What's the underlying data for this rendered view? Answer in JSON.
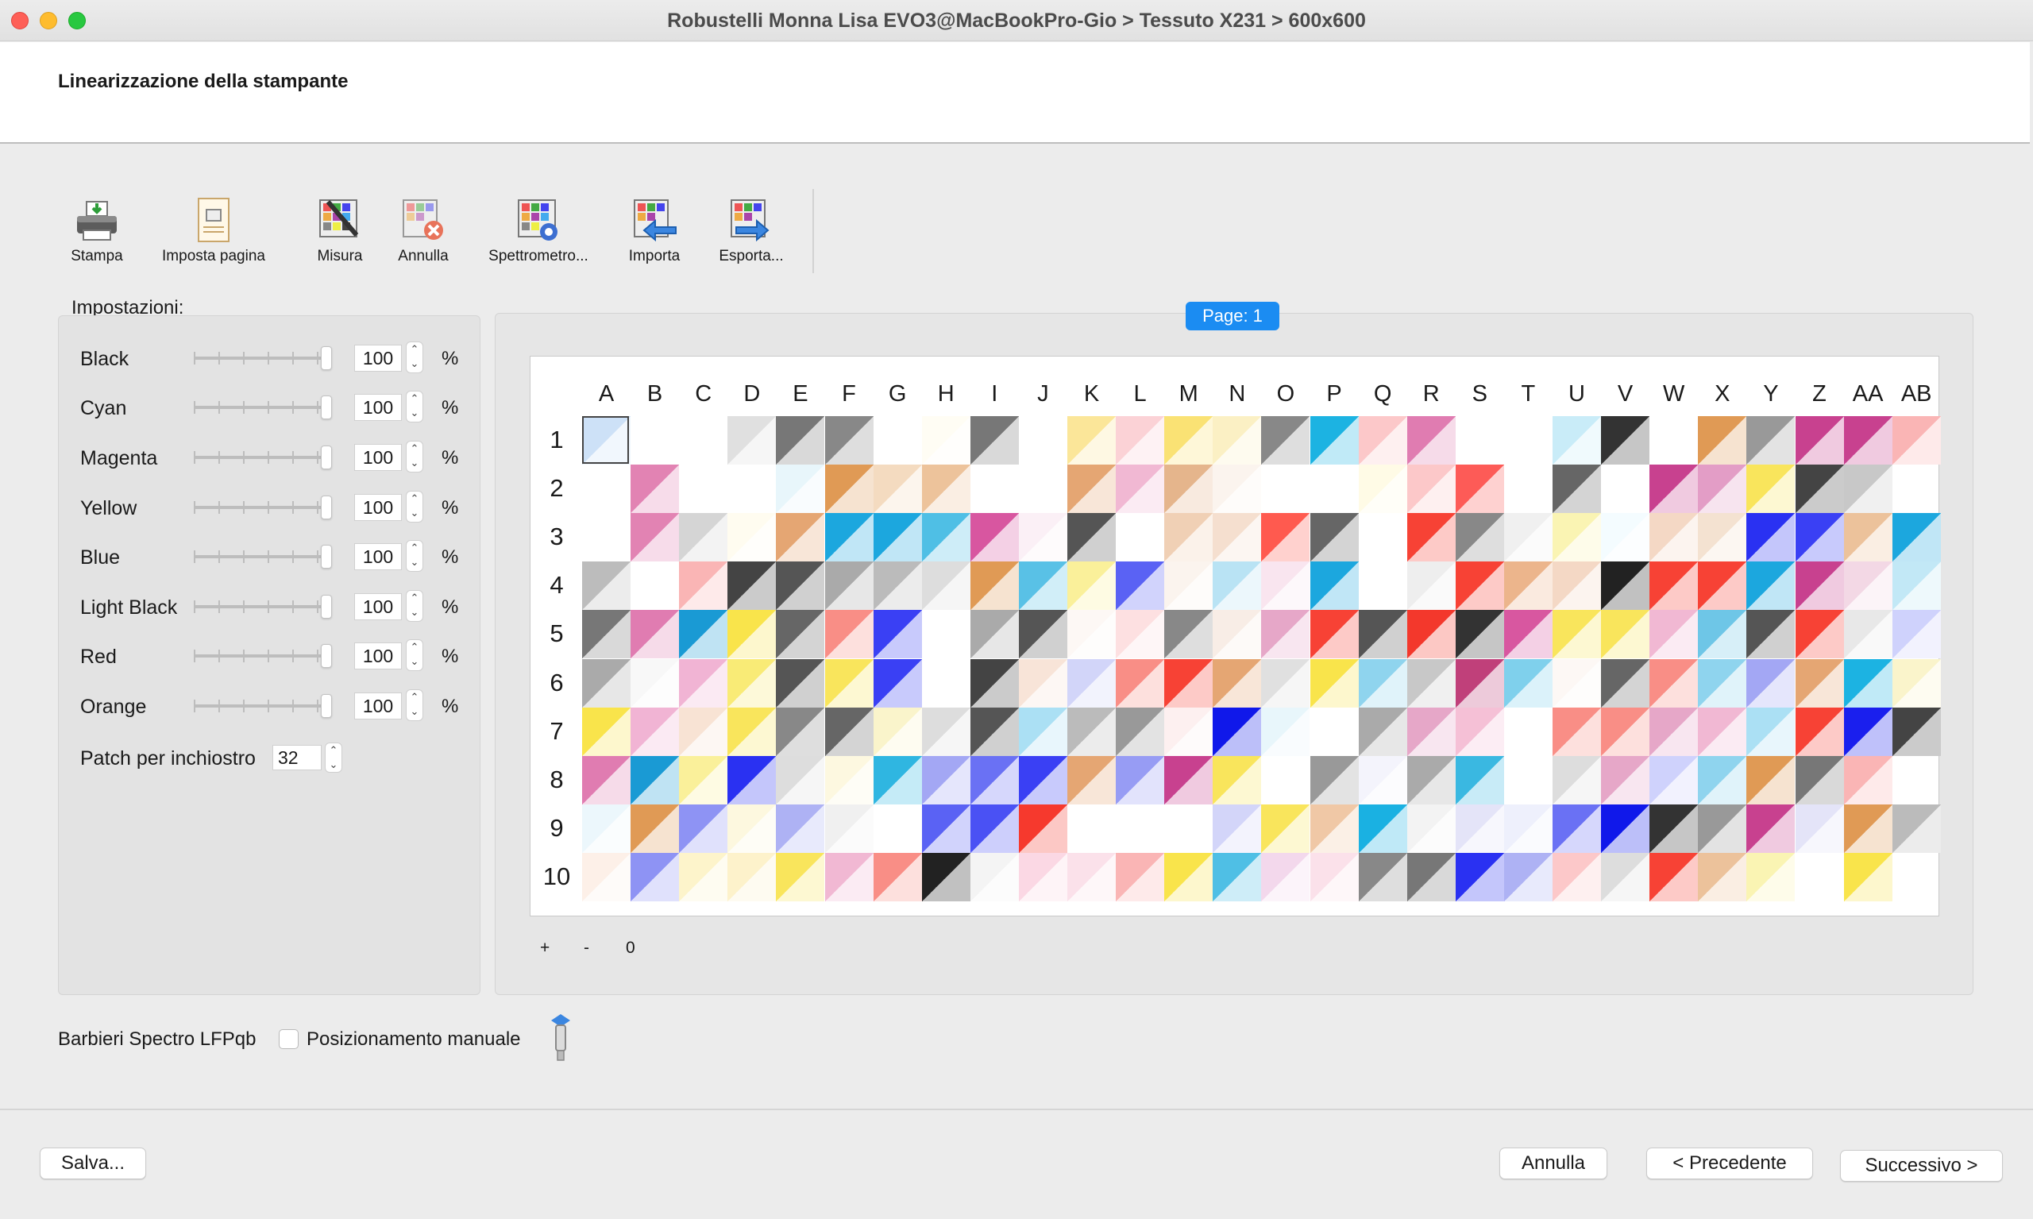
{
  "window": {
    "title": "Robustelli Monna Lisa EVO3@MacBookPro-Gio > Tessuto X231 > 600x600"
  },
  "header": {
    "title": "Linearizzazione della stampante"
  },
  "toolbar": [
    {
      "label": "Stampa",
      "icon": "printer-icon"
    },
    {
      "label": "Imposta pagina",
      "icon": "page-setup-icon"
    },
    {
      "label": "Misura",
      "icon": "measure-icon"
    },
    {
      "label": "Annulla",
      "icon": "cancel-measure-icon"
    },
    {
      "label": "Spettrometro...",
      "icon": "spectrometer-icon"
    },
    {
      "label": "Importa",
      "icon": "import-icon"
    },
    {
      "label": "Esporta...",
      "icon": "export-icon"
    }
  ],
  "settings": {
    "label": "Impostazioni:",
    "inks": [
      {
        "name": "Black",
        "value": "100",
        "unit": "%"
      },
      {
        "name": "Cyan",
        "value": "100",
        "unit": "%"
      },
      {
        "name": "Magenta",
        "value": "100",
        "unit": "%"
      },
      {
        "name": "Yellow",
        "value": "100",
        "unit": "%"
      },
      {
        "name": "Blue",
        "value": "100",
        "unit": "%"
      },
      {
        "name": "Light Black",
        "value": "100",
        "unit": "%"
      },
      {
        "name": "Red",
        "value": "100",
        "unit": "%"
      },
      {
        "name": "Orange",
        "value": "100",
        "unit": "%"
      }
    ],
    "patch_label": "Patch per inchiostro",
    "patch_value": "32"
  },
  "chart": {
    "page_label": "Page: 1",
    "columns": [
      "A",
      "B",
      "C",
      "D",
      "E",
      "F",
      "G",
      "H",
      "I",
      "J",
      "K",
      "L",
      "M",
      "N",
      "O",
      "P",
      "Q",
      "R",
      "S",
      "T",
      "U",
      "V",
      "W",
      "X",
      "Y",
      "Z",
      "AA",
      "AB"
    ],
    "rows": [
      "1",
      "2",
      "3",
      "4",
      "5",
      "6",
      "7",
      "8",
      "9",
      "10"
    ],
    "zoom_in": "+",
    "zoom_out": "-",
    "zoom_reset": "0",
    "cells": [
      "cde1f7,fff,fff,e0e0e0,777,888,fff,fffdf4,777,fff,fbe699,fbd2d6,fae274,fbf0c4,888,1cb3e2,fcc8c9,e07cb1,fff,fff,c9ecf8,333,fff,e09a55,999,c8418f,c8418f,fab5b5",
      "fff,e283b3,fff,fff,e8f6fb,e09a55,f4dbc0,edc39b,fff,fff,e5a673,f1b8d3,e5b58c,fbf4ee,fff,fff,fffbe6,fcc8c9,fd5b57,fff,666,fff,c8418f,e39dc6,f9e55c,444,c8c8c8,fff",
      "fff,e283b3,d5d5d5,fffcf0,e5a673,1ca7de,1ca7de,4fbfe5,d856a0,fbf0f6,555,fff,f0d0b5,f5dfcf,ff5a4f,666,fff,f74235,888,f0f0f0,faf4b3,f4fcff,f4d8c5,f4e2d1,2a31f2,3a40f4,ecc29b,1ca7de",
      "bcbcbc,fff,fab5b5,444,555,aaa,bbb,ddd,e09a55,59c1e6,faf09a,5a62f4,fbf4ee,b9e3f4,f9e5ef,1ca7de,fff,eee,f74235,ecb58c,f4d8c5,222,f74235,f74235,1ca7de,c8418f,f3d8e5,c2e8f6",
      "777,e07cb1,1a9ad4,f9e44b,666,f98e86,3a40f4,fff,aaa,555,fdf8f5,fde0e1,888,f8ede6,e6a7c8,f74235,555,f3382c,333,d857a0,f9e55c,f9e55c,f1b8d3,6ec6e7,555,f74235,e8e8e8,cfd2fc",
      "aaa,f8f8f8,f1b4d4,f9eb76,555,f9e55c,3a40f4,fff,444,f8e4d8,d2d5f9,f98e86,f74235,e5a673,e0e0e0,f9e44b,8fd4ee,c8c8c8,c0407a,7fd0ec,fdf8f5,666,f98e86,8fd4ee,a3a7f4,e5a673,1cb3e2,faf4cb",
      "f9e44b,f1b4d4,f8e3d4,f9e55c,888,666,faf4cb,ddd,555,abe0f4,bbb,999,fdf0f0,1018ea,e8f6fb,fff,aaa,e6a7c8,f5c0d6,fff,f98e86,f98e86,e6a7c8,f1b8d3,abe0f4,f74235,1a1fee,444",
      "e07cb1,1a9ad4,faf09a,2a31f2,ddd,fdf8e0,2fb6e1,a3a7f4,6a71f4,3a40f4,e5a673,979cf4,c8418f,f9e55c,fff,999,f4f4fc,aaa,3ab8e1,fff,ddd,e6a7c8,cfd2fc,8fd4ee,e09a55,777,fab5b5,fff",
      "ecf7fc,e09a55,8e93f4,fdf8df,aeb2f4,f0f0f0,fff,5a62f4,4a51f4,f6392d,fff,fff,fff,d3d5f9,f9e55c,f0c8a6,1ab1e2,f3f3f3,e4e4f8,eef0fc,6a71f4,1018ea,333,999,c8418f,e4e4f8,e09a55,bbb",
      "fdf0e8,8e93f4,fdf4cb,fdf2cb,f9e55c,f1b8d3,f98e86,222,f4f4f4,fbd8e4,fbe1ea,fab5b5,f9e44b,4fbfe5,f3d8ec,fbe1ea,888,777,2a31f2,aeb2f4,fcc8c9,ddd,f74235,ecc29b,faf4b3,fff,f9e44b,fff"
    ]
  }
}
